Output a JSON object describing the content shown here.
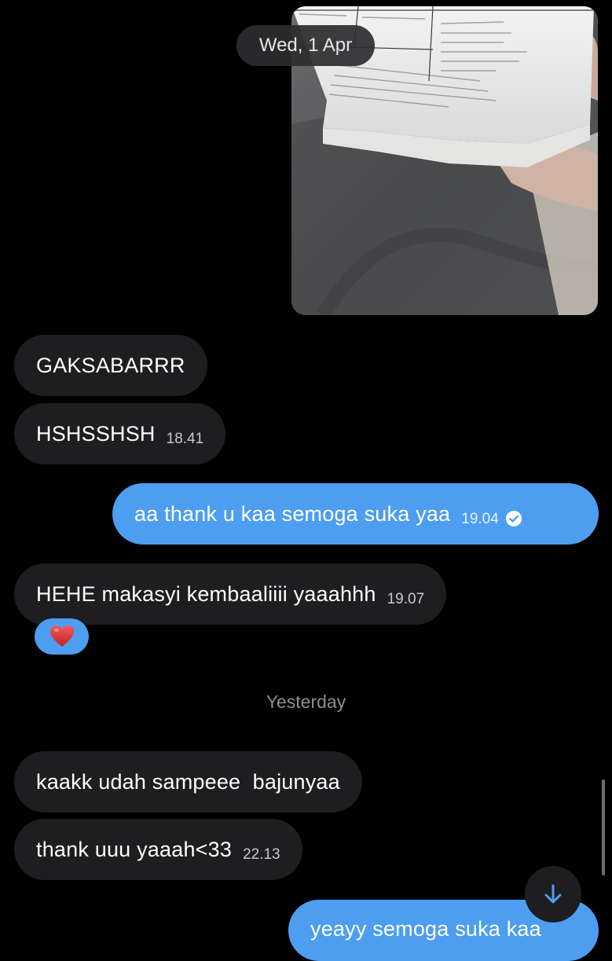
{
  "header": {
    "date_label": "Wed, 1 Apr"
  },
  "attachment": {
    "type": "photo"
  },
  "messages": [
    {
      "direction": "incoming",
      "text": "GAKSABARRR",
      "time": ""
    },
    {
      "direction": "incoming",
      "text": "HSHSSHSH",
      "time": "18.41"
    },
    {
      "direction": "outgoing",
      "text": "aa thank u kaa semoga suka yaa",
      "time": "19.04",
      "status": "read"
    },
    {
      "direction": "incoming",
      "text": "HEHE makasyi kembaaliiii yaaahhh",
      "time": "19.07",
      "reaction": "red-heart"
    },
    {
      "direction": "incoming",
      "text": "kaakk udah sampeee  bajunyaa",
      "time": ""
    },
    {
      "direction": "incoming",
      "text": "thank uuu yaaah<33",
      "time": "22.13"
    },
    {
      "direction": "outgoing",
      "text": "yeayy semoga suka kaa",
      "time": ""
    }
  ],
  "divider": {
    "label": "Yesterday"
  },
  "colors": {
    "background": "#000000",
    "incoming_bubble": "#1e1e20",
    "outgoing_bubble": "#4d9ef0",
    "muted_text": "#8d8d92"
  },
  "icons": {
    "read_status": "check-circle-icon",
    "reaction": "heart-icon",
    "scroll": "arrow-down-icon"
  }
}
